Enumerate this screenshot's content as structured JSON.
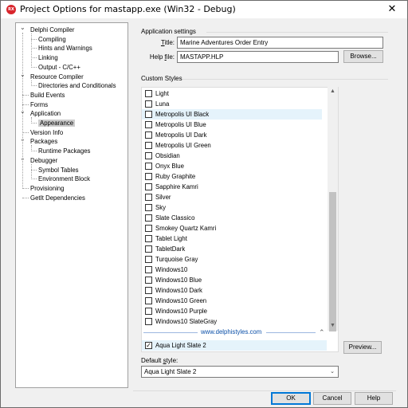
{
  "window": {
    "title": "Project Options for mastapp.exe  (Win32 - Debug)",
    "icon_text": "RX",
    "close_glyph": "✕"
  },
  "tree": {
    "items": [
      {
        "label": "Delphi Compiler",
        "level": 0,
        "expanded": true
      },
      {
        "label": "Compiling",
        "level": 1
      },
      {
        "label": "Hints and Warnings",
        "level": 1
      },
      {
        "label": "Linking",
        "level": 1
      },
      {
        "label": "Output - C/C++",
        "level": 1
      },
      {
        "label": "Resource Compiler",
        "level": 0,
        "expanded": true
      },
      {
        "label": "Directories and Conditionals",
        "level": 1
      },
      {
        "label": "Build Events",
        "level": 0
      },
      {
        "label": "Forms",
        "level": 0
      },
      {
        "label": "Application",
        "level": 0,
        "expanded": true
      },
      {
        "label": "Appearance",
        "level": 1,
        "selected": true
      },
      {
        "label": "Version Info",
        "level": 0
      },
      {
        "label": "Packages",
        "level": 0,
        "expanded": true
      },
      {
        "label": "Runtime Packages",
        "level": 1
      },
      {
        "label": "Debugger",
        "level": 0,
        "expanded": true
      },
      {
        "label": "Symbol Tables",
        "level": 1
      },
      {
        "label": "Environment Block",
        "level": 1
      },
      {
        "label": "Provisioning",
        "level": 0
      },
      {
        "label": "GetIt Dependencies",
        "level": 0
      }
    ]
  },
  "app_settings": {
    "group_title": "Application settings",
    "title_label_pre": "",
    "title_label_u": "T",
    "title_label_post": "itle:",
    "title_value": "Marine Adventures Order Entry",
    "helpfile_label_pre": "Help ",
    "helpfile_label_u": "f",
    "helpfile_label_post": "ile:",
    "helpfile_value": "MASTAPP.HLP",
    "browse_label": "Browse..."
  },
  "custom_styles": {
    "group_title": "Custom Styles",
    "items": [
      {
        "label": "Light",
        "checked": false
      },
      {
        "label": "Luna",
        "checked": false
      },
      {
        "label": "Metropolis UI Black",
        "checked": false,
        "highlight": true
      },
      {
        "label": "Metropolis UI Blue",
        "checked": false
      },
      {
        "label": "Metropolis UI Dark",
        "checked": false
      },
      {
        "label": "Metropolis UI Green",
        "checked": false
      },
      {
        "label": "Obsidian",
        "checked": false
      },
      {
        "label": "Onyx Blue",
        "checked": false
      },
      {
        "label": "Ruby Graphite",
        "checked": false
      },
      {
        "label": "Sapphire Kamri",
        "checked": false
      },
      {
        "label": "Silver",
        "checked": false
      },
      {
        "label": "Sky",
        "checked": false
      },
      {
        "label": "Slate Classico",
        "checked": false
      },
      {
        "label": "Smokey Quartz Kamri",
        "checked": false
      },
      {
        "label": "Tablet Light",
        "checked": false
      },
      {
        "label": "TabletDark",
        "checked": false
      },
      {
        "label": "Turquoise Gray",
        "checked": false
      },
      {
        "label": "Windows10",
        "checked": false
      },
      {
        "label": "Windows10 Blue",
        "checked": false
      },
      {
        "label": "Windows10 Dark",
        "checked": false
      },
      {
        "label": "Windows10 Green",
        "checked": false
      },
      {
        "label": "Windows10 Purple",
        "checked": false
      },
      {
        "label": "Windows10 SlateGray",
        "checked": false
      }
    ],
    "link_text": "www.delphistyles.com",
    "pinned_item": {
      "label": "Aqua Light Slate 2",
      "checked": true
    },
    "preview_label": "Preview..."
  },
  "default_style": {
    "label_pre": "Default ",
    "label_u": "s",
    "label_post": "tyle:",
    "value": "Aqua Light Slate 2"
  },
  "footer": {
    "ok_label": "OK",
    "cancel_label": "Cancel",
    "help_label": "Help"
  },
  "colors": {
    "accent": "#0078d7",
    "selection": "#cccccc",
    "highlight_row": "#e5f3fb",
    "link": "#0a4fa8"
  }
}
